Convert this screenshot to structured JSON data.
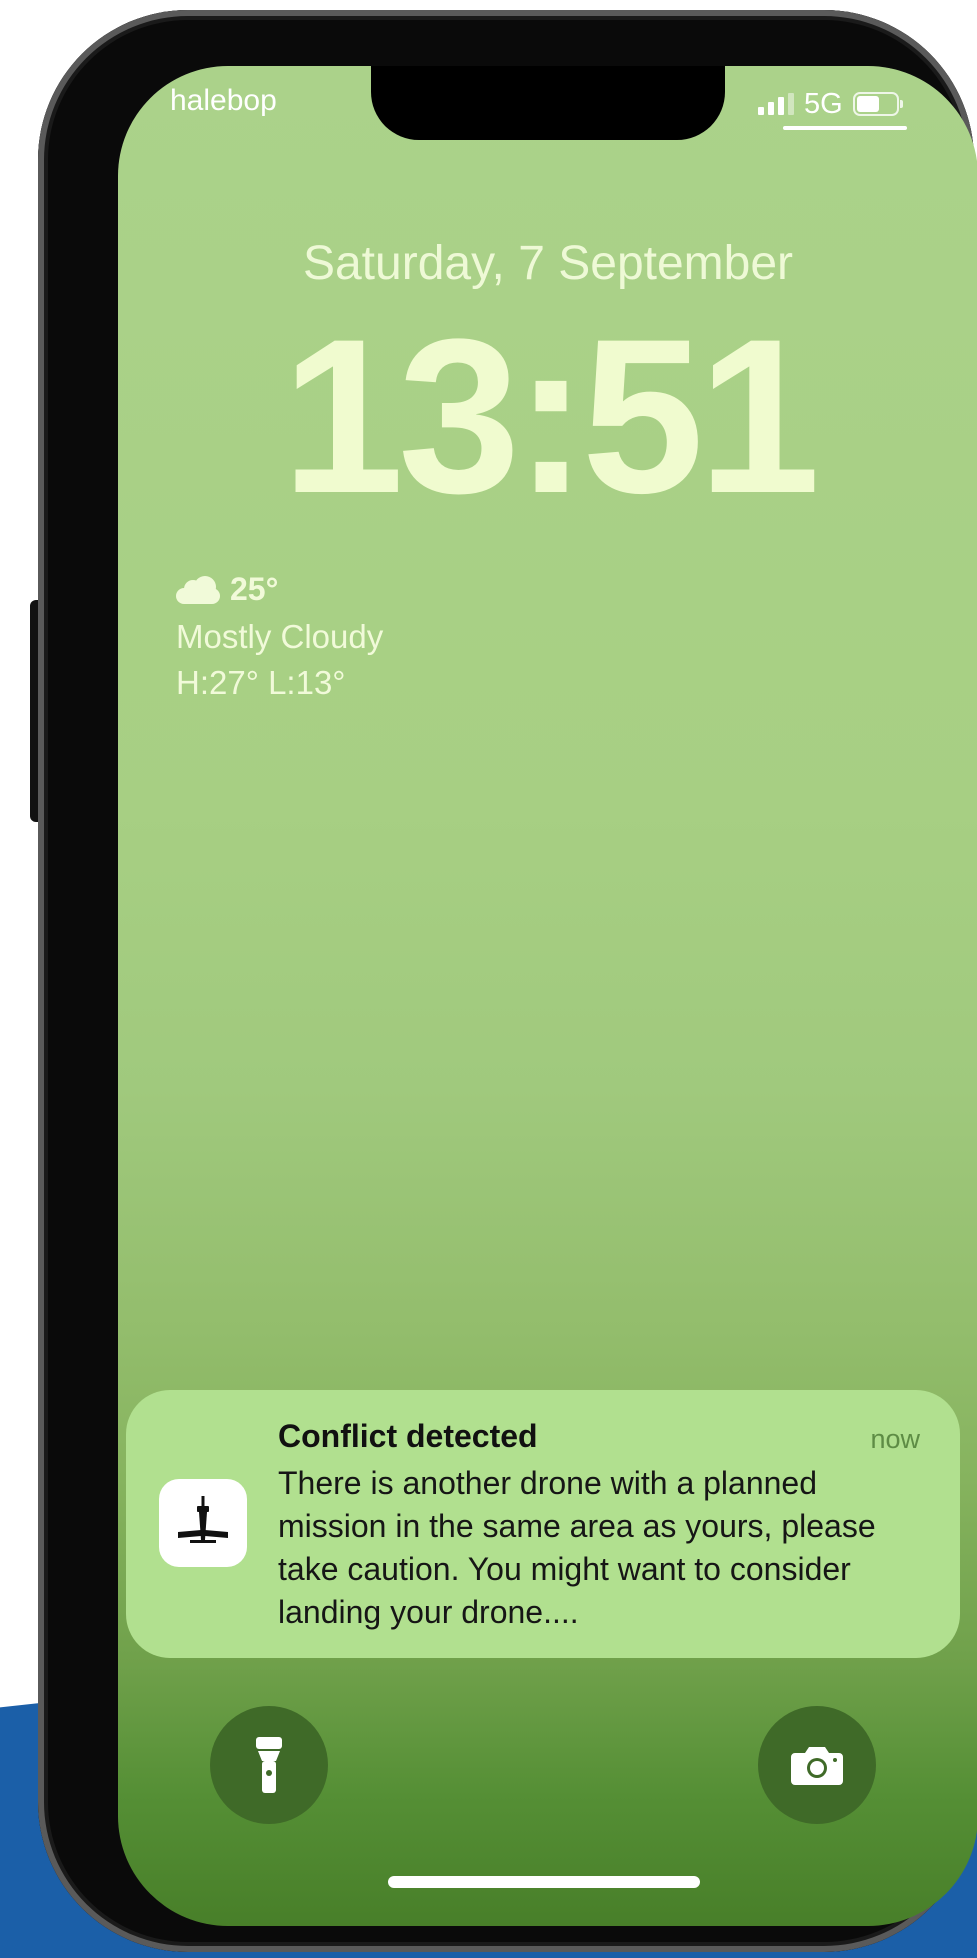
{
  "status_bar": {
    "carrier": "halebop",
    "network": "5G",
    "icons": [
      "signal-icon",
      "battery-icon"
    ]
  },
  "lock_screen": {
    "date": "Saturday, 7 September",
    "time": "13:51"
  },
  "weather": {
    "icon": "cloud-icon",
    "temperature": "25°",
    "condition": "Mostly Cloudy",
    "high_low": "H:27° L:13°"
  },
  "notification": {
    "app_icon": "drone-app-icon",
    "title": "Conflict detected",
    "time": "now",
    "body": "There is another drone with a planned mission in the same area as yours, please take caution. You might want to consider landing your drone...."
  },
  "quick_actions": {
    "left": "flashlight-icon",
    "right": "camera-icon"
  },
  "colors": {
    "wallpaper_top": "#abd28a",
    "wallpaper_bottom": "#487f29",
    "notification_bg": "#b1e08f",
    "accent_blue": "#1b5fa8"
  }
}
